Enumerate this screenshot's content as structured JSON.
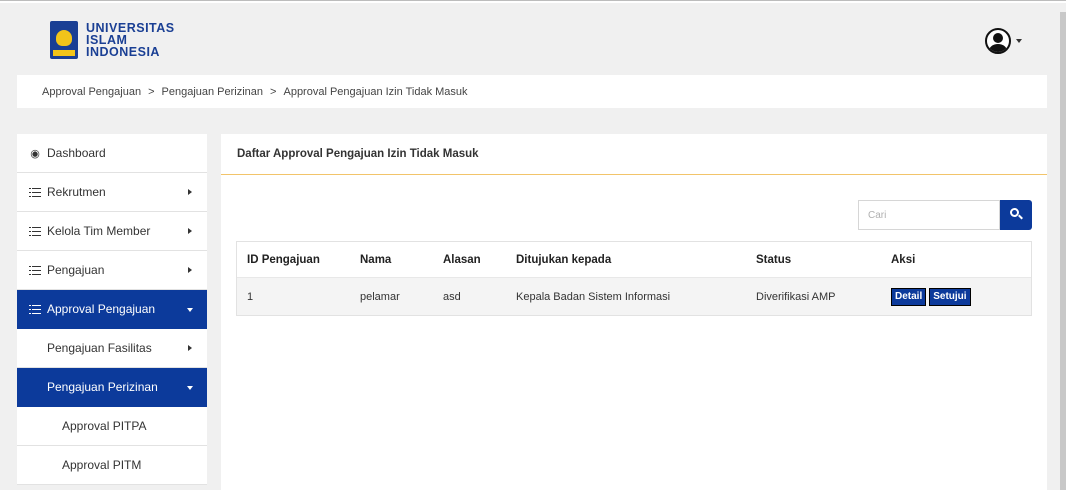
{
  "header": {
    "logo_line1": "UNIVERSITAS",
    "logo_line2": "ISLAM",
    "logo_line3": "INDONESIA"
  },
  "breadcrumb": [
    "Approval Pengajuan",
    "Pengajuan Perizinan",
    "Approval Pengajuan Izin Tidak Masuk"
  ],
  "breadcrumb_sep": ">",
  "sidebar": {
    "dashboard": "Dashboard",
    "rekrutmen": "Rekrutmen",
    "kelola_tim": "Kelola Tim Member",
    "pengajuan": "Pengajuan",
    "approval_pengajuan": "Approval Pengajuan",
    "pengajuan_fasilitas": "Pengajuan Fasilitas",
    "pengajuan_perizinan": "Pengajuan Perizinan",
    "approval_pitpa": "Approval PITPA",
    "approval_pitm": "Approval PITM"
  },
  "panel": {
    "title": "Daftar Approval Pengajuan Izin Tidak Masuk",
    "search_placeholder": "Cari"
  },
  "table": {
    "headers": [
      "ID Pengajuan",
      "Nama",
      "Alasan",
      "Ditujukan kepada",
      "Status",
      "Aksi"
    ],
    "rows": [
      {
        "id": "1",
        "nama": "pelamar",
        "alasan": "asd",
        "tujuan": "Kepala Badan Sistem Informasi",
        "status": "Diverifikasi AMP",
        "detail_label": "Detail",
        "approve_label": "Setujui"
      }
    ]
  },
  "colors": {
    "accent": "#0c3a9b",
    "panel_divider": "#f2c46a",
    "background": "#f0f0f0"
  },
  "icons": {
    "user": "user-circle-icon",
    "search": "search-icon",
    "dashboard": "tachometer-icon",
    "list": "list-icon"
  }
}
